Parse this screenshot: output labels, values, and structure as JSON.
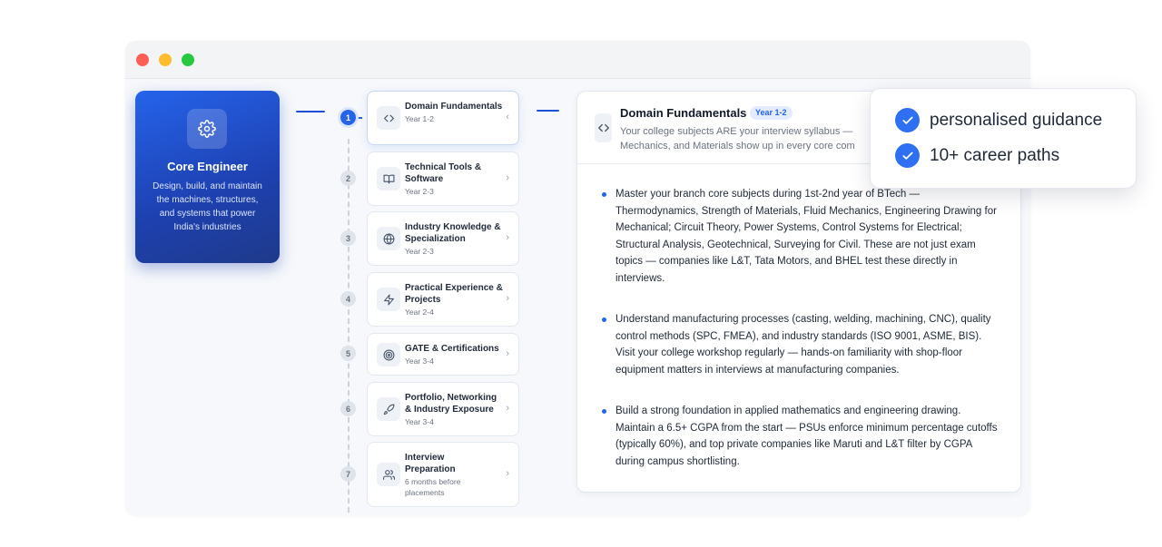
{
  "window": {
    "controls": [
      "close",
      "minimize",
      "maximize"
    ]
  },
  "role": {
    "icon": "gear-icon",
    "title": "Core Engineer",
    "description": "Design, build, and maintain the machines, structures, and systems that power India's industries"
  },
  "steps": [
    {
      "number": "1",
      "title": "Domain Fundamentals",
      "year": "Year 1-2",
      "icon": "code-icon",
      "active": true
    },
    {
      "number": "2",
      "title": "Technical Tools & Software",
      "year": "Year 2-3",
      "icon": "book-icon"
    },
    {
      "number": "3",
      "title": "Industry Knowledge & Specialization",
      "year": "Year 2-3",
      "icon": "globe-icon"
    },
    {
      "number": "4",
      "title": "Practical Experience & Projects",
      "year": "Year 2-4",
      "icon": "bolt-icon"
    },
    {
      "number": "5",
      "title": "GATE & Certifications",
      "year": "Year 3-4",
      "icon": "target-icon"
    },
    {
      "number": "6",
      "title": "Portfolio, Networking & Industry Exposure",
      "year": "Year 3-4",
      "icon": "rocket-icon"
    },
    {
      "number": "7",
      "title": "Interview Preparation",
      "year": "6 months before placements",
      "icon": "users-icon"
    }
  ],
  "detail": {
    "icon": "code-icon",
    "title": "Domain Fundamentals",
    "badge": "Year 1-2",
    "subtitle_line1": "Your college subjects ARE your interview syllabus —",
    "subtitle_line2": "Mechanics, and Materials show up in every core com",
    "bullets": [
      "Master your branch core subjects during 1st-2nd year of BTech — Thermodynamics, Strength of Materials, Fluid Mechanics, Engineering Drawing for Mechanical; Circuit Theory, Power Systems, Control Systems for Electrical; Structural Analysis, Geotechnical, Surveying for Civil. These are not just exam topics — companies like L&T, Tata Motors, and BHEL test these directly in interviews.",
      "Understand manufacturing processes (casting, welding, machining, CNC), quality control methods (SPC, FMEA), and industry standards (ISO 9001, ASME, BIS). Visit your college workshop regularly — hands-on familiarity with shop-floor equipment matters in interviews at manufacturing companies.",
      "Build a strong foundation in applied mathematics and engineering drawing. Maintain a 6.5+ CGPA from the start — PSUs enforce minimum percentage cutoffs (typically 60%), and top private companies like Maruti and L&T filter by CGPA during campus shortlisting."
    ]
  },
  "popover": {
    "items": [
      "personalised guidance",
      "10+ career paths"
    ]
  },
  "colors": {
    "accent": "#2563eb",
    "card_gradient_start": "#2563eb",
    "card_gradient_end": "#1e3a8a"
  }
}
